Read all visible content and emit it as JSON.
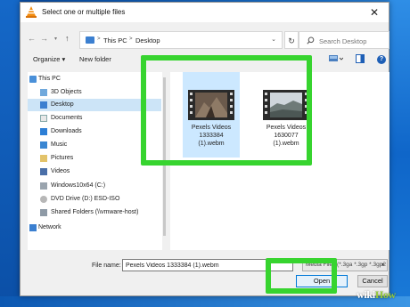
{
  "window": {
    "title": "Select one or multiple files",
    "close_glyph": "✕"
  },
  "address": {
    "crumbs": [
      "This PC",
      "Desktop"
    ],
    "search_placeholder": "Search Desktop"
  },
  "toolbar": {
    "organize_label": "Organize ▾",
    "new_folder_label": "New folder"
  },
  "nav": {
    "items": [
      {
        "label": "This PC",
        "icon": "computer-icon"
      },
      {
        "label": "3D Objects",
        "icon": "cube-folder-icon"
      },
      {
        "label": "Desktop",
        "icon": "desktop-folder-icon",
        "selected": true
      },
      {
        "label": "Documents",
        "icon": "documents-folder-icon"
      },
      {
        "label": "Downloads",
        "icon": "downloads-folder-icon"
      },
      {
        "label": "Music",
        "icon": "music-folder-icon"
      },
      {
        "label": "Pictures",
        "icon": "pictures-folder-icon"
      },
      {
        "label": "Videos",
        "icon": "videos-folder-icon"
      },
      {
        "label": "Windows10x64 (C:)",
        "icon": "drive-icon"
      },
      {
        "label": "DVD Drive (D:) ESD-ISO",
        "icon": "dvd-drive-icon"
      },
      {
        "label": "Shared Folders (\\\\vmware-host)",
        "icon": "network-drive-icon"
      },
      {
        "label": "Network",
        "icon": "network-icon"
      }
    ]
  },
  "files": [
    {
      "name_lines": [
        "Pexels Videos",
        "1333384",
        "(1).webm"
      ],
      "selected": true
    },
    {
      "name_lines": [
        "Pexels Videos",
        "1630077",
        "(1).webm"
      ],
      "selected": false
    }
  ],
  "footer": {
    "file_name_label": "File name:",
    "file_name_value": "Pexels Videos 1333384 (1).webm",
    "file_type_value": "Media Files (*.3ga *.3gp *.3gp2",
    "open_label": "Open",
    "cancel_label": "Cancel"
  },
  "watermark": {
    "wiki": "wiki",
    "how": "How"
  },
  "colors": {
    "highlight": "#37d42f",
    "selection": "#cce8ff",
    "accent": "#0078d7"
  }
}
